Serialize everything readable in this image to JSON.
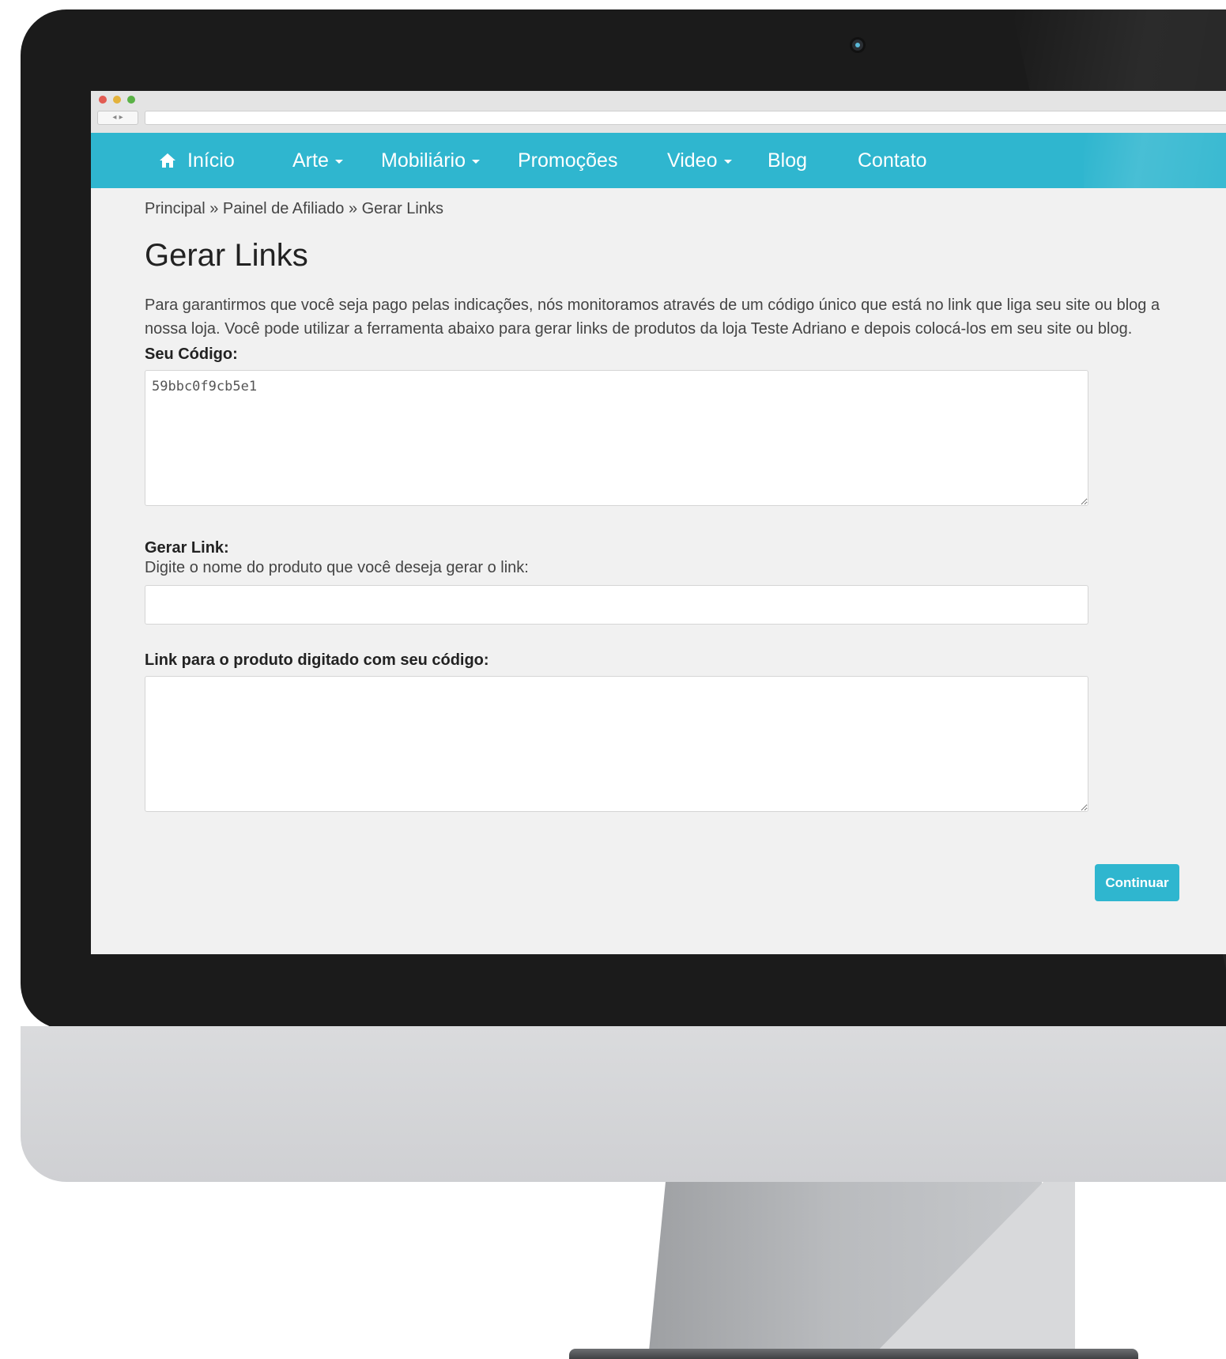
{
  "nav": {
    "items": [
      {
        "label": "Início",
        "icon": "home-icon",
        "dropdown": false
      },
      {
        "label": "Arte",
        "dropdown": true
      },
      {
        "label": "Mobiliário",
        "dropdown": true
      },
      {
        "label": "Promoções",
        "dropdown": false
      },
      {
        "label": "Video",
        "dropdown": true
      },
      {
        "label": "Blog",
        "dropdown": false
      },
      {
        "label": "Contato",
        "dropdown": false
      }
    ]
  },
  "breadcrumb": "Principal » Painel de Afiliado » Gerar Links",
  "page": {
    "title": "Gerar Links",
    "intro": "Para garantirmos que você seja pago pelas indicações, nós monitoramos através de um código único que está no link que liga seu site ou blog a nossa loja. Você pode utilizar a ferramenta abaixo para gerar links de produtos da loja Teste Adriano e depois colocá-los em seu site ou blog."
  },
  "form": {
    "code_label": "Seu Código:",
    "code_value": "59bbc0f9cb5e1",
    "generate_label": "Gerar Link:",
    "generate_hint": "Digite o nome do produto que você deseja gerar o link:",
    "product_value": "",
    "result_label": "Link para o produto digitado com seu código:",
    "result_value": "",
    "continue_label": "Continuar"
  },
  "colors": {
    "accent": "#2fb6cf",
    "bezel": "#1b1b1b",
    "screen_bg": "#f1f1f1"
  }
}
